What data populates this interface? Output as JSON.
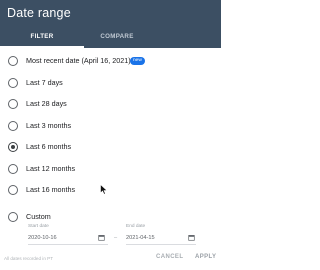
{
  "dialog": {
    "title": "Date range",
    "tabs": [
      {
        "label": "FILTER",
        "active": true
      },
      {
        "label": "COMPARE",
        "active": false
      }
    ]
  },
  "options": [
    {
      "label": "Most recent date (April 16, 2021)",
      "badge": "new",
      "checked": false
    },
    {
      "label": "Last 7 days",
      "checked": false
    },
    {
      "label": "Last 28 days",
      "checked": false
    },
    {
      "label": "Last 3 months",
      "checked": false
    },
    {
      "label": "Last 6 months",
      "checked": true
    },
    {
      "label": "Last 12 months",
      "checked": false
    },
    {
      "label": "Last 16 months",
      "checked": false
    },
    {
      "label": "Custom",
      "checked": false
    }
  ],
  "custom": {
    "start_label": "Start date",
    "start_value": "2020-10-16",
    "end_label": "End date",
    "end_value": "2021-04-15"
  },
  "footer": {
    "note": "All dates recorded in PT",
    "cancel": "CANCEL",
    "apply": "APPLY"
  },
  "colors": {
    "header_bg": "#3c4f63",
    "badge_bg": "#1a73e8"
  }
}
